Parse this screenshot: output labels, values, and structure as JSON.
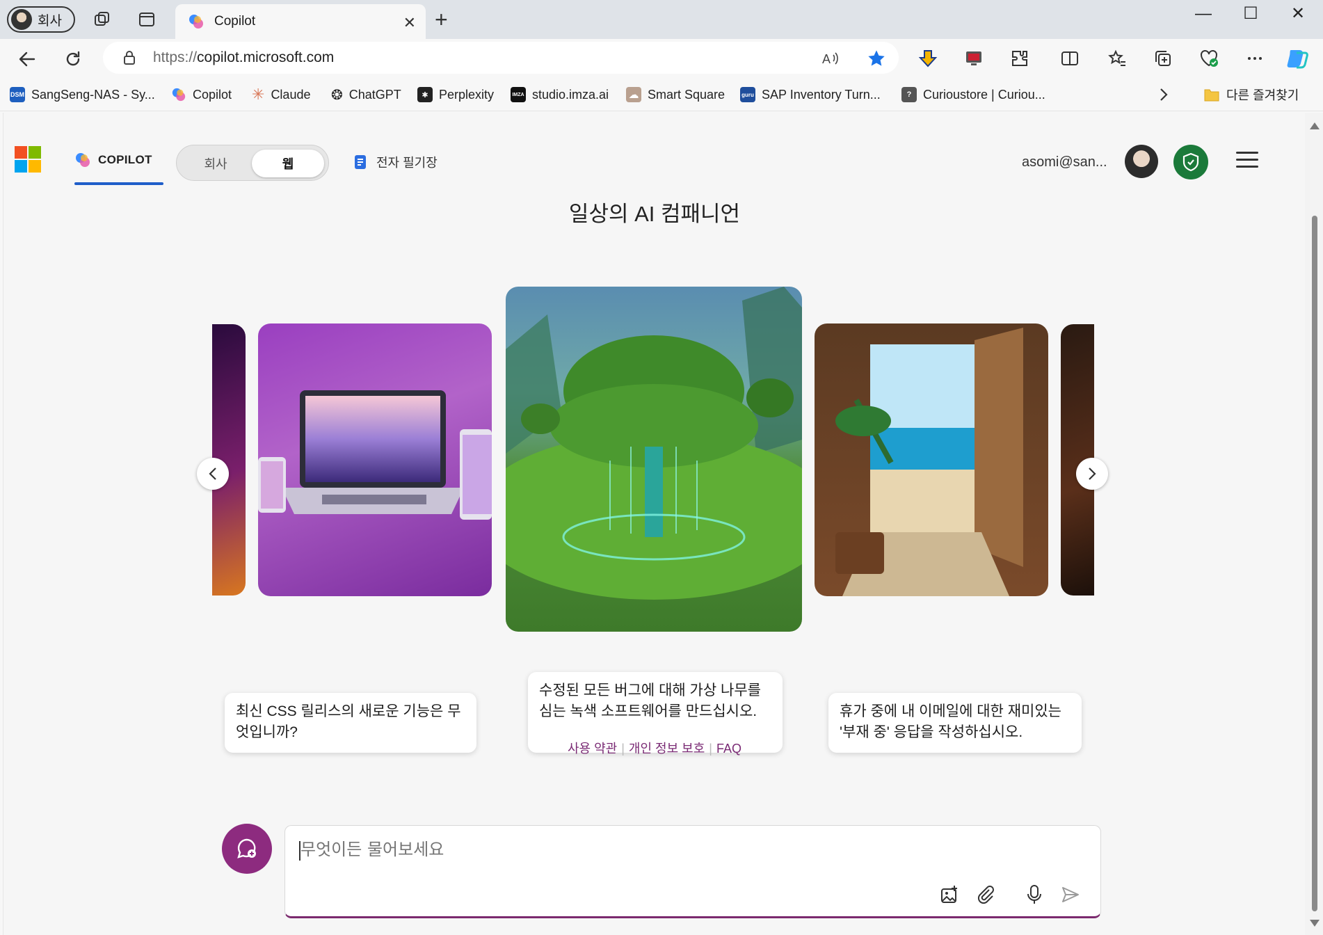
{
  "browser": {
    "profile_label": "회사",
    "active_tab_title": "Copilot",
    "url_protocol": "https://",
    "url_host": "copilot.microsoft.com",
    "favorites": [
      {
        "label": "SangSeng-NAS - Sy...",
        "icon": "dsm-icon",
        "color": "#1e5fbf",
        "glyph": "DSM"
      },
      {
        "label": "Copilot",
        "icon": "copilot-icon",
        "color": "#4aa3ff",
        "glyph": ""
      },
      {
        "label": "Claude",
        "icon": "claude-icon",
        "color": "#d97757",
        "glyph": "✳"
      },
      {
        "label": "ChatGPT",
        "icon": "chatgpt-icon",
        "color": "#222222",
        "glyph": "❂"
      },
      {
        "label": "Perplexity",
        "icon": "perplexity-icon",
        "color": "#222222",
        "glyph": "✱"
      },
      {
        "label": "studio.imza.ai",
        "icon": "imza-icon",
        "color": "#111111",
        "glyph": "IMZA"
      },
      {
        "label": "Smart Square",
        "icon": "cloud-icon",
        "color": "#b9a08f",
        "glyph": "☁"
      },
      {
        "label": "SAP Inventory Turn...",
        "icon": "guru-icon",
        "color": "#1f4e9c",
        "glyph": "guru"
      },
      {
        "label": "Curioustore | Curiou...",
        "icon": "question-icon",
        "color": "#555555",
        "glyph": "?"
      }
    ],
    "other_favorites": "다른 즐겨찾기"
  },
  "page": {
    "copilot_tab": "COPILOT",
    "mode_options": [
      "회사",
      "웹"
    ],
    "mode_selected": "웹",
    "notebook": "전자 필기장",
    "user_email": "asomi@san...",
    "headline": "일상의 AI 컴패니언",
    "cards": [
      {
        "caption": "최신 CSS 릴리스의 새로운 기능은 무엇입니까?",
        "image": "laptop-devices-image"
      },
      {
        "caption": "수정된 모든 버그에 대해 가상 나무를 심는 녹색 소프트웨어를 만드십시오.",
        "image": "digital-tree-image"
      },
      {
        "caption": "휴가 중에 내 이메일에 대한 재미있는 '부재 중' 응답을 작성하십시오.",
        "image": "beach-door-image"
      }
    ],
    "footer_links": [
      "사용 약관",
      "개인 정보 보호",
      "FAQ"
    ],
    "chat_placeholder": "무엇이든 물어보세요"
  },
  "colors": {
    "accent": "#1f5ec9",
    "brand_purple": "#8d2b7f",
    "link": "#7a2a74",
    "shield_green": "#1b7a3a"
  }
}
